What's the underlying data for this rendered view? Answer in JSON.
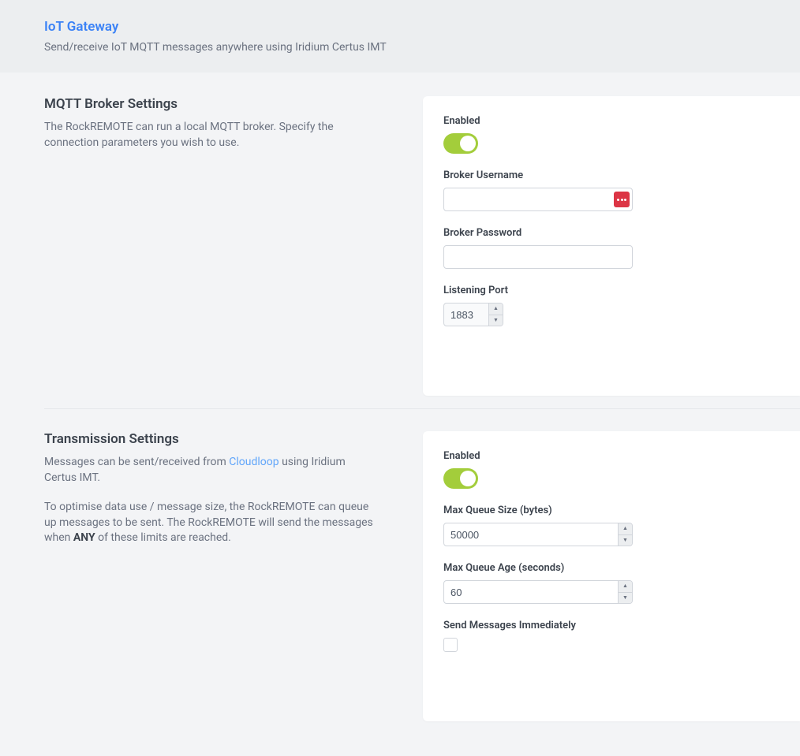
{
  "header": {
    "title": "IoT Gateway",
    "subtitle": "Send/receive IoT MQTT messages anywhere using Iridium Certus IMT"
  },
  "broker": {
    "title": "MQTT Broker Settings",
    "desc": "The RockREMOTE can run a local MQTT broker. Specify the connection parameters you wish to use.",
    "enabled_label": "Enabled",
    "username_label": "Broker Username",
    "username_value": "",
    "password_label": "Broker Password",
    "password_value": "",
    "port_label": "Listening Port",
    "port_value": "1883"
  },
  "transmission": {
    "title": "Transmission Settings",
    "desc_prefix": "Messages can be sent/received from ",
    "link_text": "Cloudloop",
    "desc_suffix": " using Iridium Certus IMT.",
    "desc2_prefix": "To optimise data use / message size, the RockREMOTE can queue up messages to be sent. The RockREMOTE will send the messages when ",
    "desc2_bold": "ANY",
    "desc2_suffix": " of these limits are reached.",
    "enabled_label": "Enabled",
    "max_queue_size_label": "Max Queue Size (bytes)",
    "max_queue_size_value": "50000",
    "max_queue_age_label": "Max Queue Age (seconds)",
    "max_queue_age_value": "60",
    "send_immediately_label": "Send Messages Immediately"
  }
}
